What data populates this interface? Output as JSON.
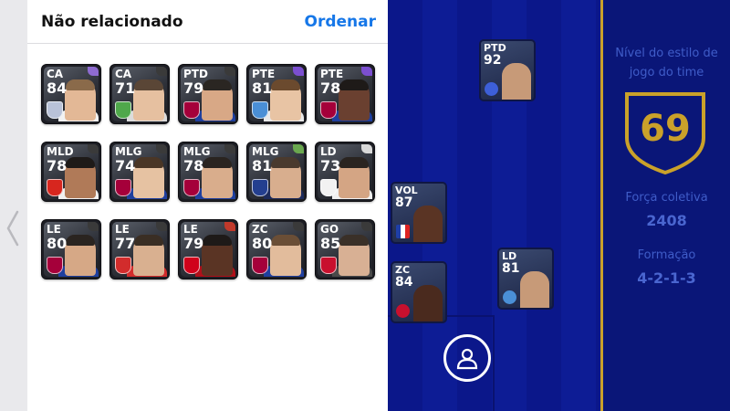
{
  "sheet": {
    "title": "Não relacionado",
    "sort_label": "Ordenar"
  },
  "unassigned_players": [
    {
      "position": "CA",
      "rating": "84",
      "club_color": "#b9c2d8",
      "accent": "#8e6bd0",
      "skin": "#e3b896",
      "hair": "#8a6a4a",
      "shirt": "#f2f2f2"
    },
    {
      "position": "CA",
      "rating": "71",
      "club_color": "#4fa84b",
      "accent": "#3a3a3a",
      "skin": "#e6c0a0",
      "hair": "#5a4636",
      "shirt": "#dcdcdc"
    },
    {
      "position": "PTD",
      "rating": "79",
      "club_color": "#a5003a",
      "accent": "#3a3a3a",
      "skin": "#d8a886",
      "hair": "#2a2622",
      "shirt": "#1f3f9e"
    },
    {
      "position": "PTE",
      "rating": "81",
      "club_color": "#4a8fd6",
      "accent": "#7b4fd0",
      "skin": "#e8c4a4",
      "hair": "#6b4a2e",
      "shirt": "#e9e9e9"
    },
    {
      "position": "PTE",
      "rating": "78",
      "club_color": "#a5003a",
      "accent": "#7b4fd0",
      "skin": "#6a4030",
      "hair": "#1e1a18",
      "shirt": "#1f3f9e"
    },
    {
      "position": "MLD",
      "rating": "78",
      "club_color": "#d7261e",
      "accent": "#3a3a3a",
      "skin": "#b07a58",
      "hair": "#1e1a18",
      "shirt": "#f1f1f1"
    },
    {
      "position": "MLG",
      "rating": "74",
      "club_color": "#a5003a",
      "accent": "#3a3a3a",
      "skin": "#e6c2a2",
      "hair": "#4a3626",
      "shirt": "#1f3f9e"
    },
    {
      "position": "MLG",
      "rating": "78",
      "club_color": "#a5003a",
      "accent": "#3a3a3a",
      "skin": "#d9ad8c",
      "hair": "#2a2420",
      "shirt": "#1f3f9e"
    },
    {
      "position": "MLG",
      "rating": "81",
      "club_color": "#243f8f",
      "accent": "#6aa84f",
      "skin": "#d8ae8e",
      "hair": "#4a3a2e",
      "shirt": "#1c2a5a"
    },
    {
      "position": "LD",
      "rating": "73",
      "club_color": "#f2f2f2",
      "accent": "#d8d8d8",
      "skin": "#d4a584",
      "hair": "#2a2420",
      "shirt": "#f0f0f0"
    },
    {
      "position": "LE",
      "rating": "80",
      "club_color": "#a5003a",
      "accent": "#3a3a3a",
      "skin": "#d6a886",
      "hair": "#2a2420",
      "shirt": "#1f3f9e"
    },
    {
      "position": "LE",
      "rating": "77",
      "club_color": "#d22c2c",
      "accent": "#3a3a3a",
      "skin": "#d9b090",
      "hair": "#3a2e24",
      "shirt": "#d22c2c"
    },
    {
      "position": "LE",
      "rating": "79",
      "club_color": "#d0021b",
      "accent": "#c0392b",
      "skin": "#5a3424",
      "hair": "#1e1a18",
      "shirt": "#b0101a"
    },
    {
      "position": "ZC",
      "rating": "80",
      "club_color": "#a5003a",
      "accent": "#3a3a3a",
      "skin": "#e2bc9c",
      "hair": "#6a4e36",
      "shirt": "#1f3f9e"
    },
    {
      "position": "GO",
      "rating": "85",
      "club_color": "#c8102e",
      "accent": "#3a3a3a",
      "skin": "#d8b094",
      "hair": "#3a3028",
      "shirt": "#4a4a4a"
    }
  ],
  "field_players": [
    {
      "position": "PTD",
      "rating": "92"
    },
    {
      "position": "VOL",
      "rating": "87"
    },
    {
      "position": "LD",
      "rating": "81"
    },
    {
      "position": "ZC",
      "rating": "84"
    }
  ],
  "team_panel": {
    "style_label": "Nível do estilo de jogo do time",
    "style_value": "69",
    "strength_label": "Força coletiva",
    "strength_value": "2408",
    "formation_label": "Formação",
    "formation_value": "4-2-1-3"
  },
  "colors": {
    "accent_blue": "#1677e8",
    "gold": "#caa12a",
    "field_blue": "#0a1478"
  }
}
